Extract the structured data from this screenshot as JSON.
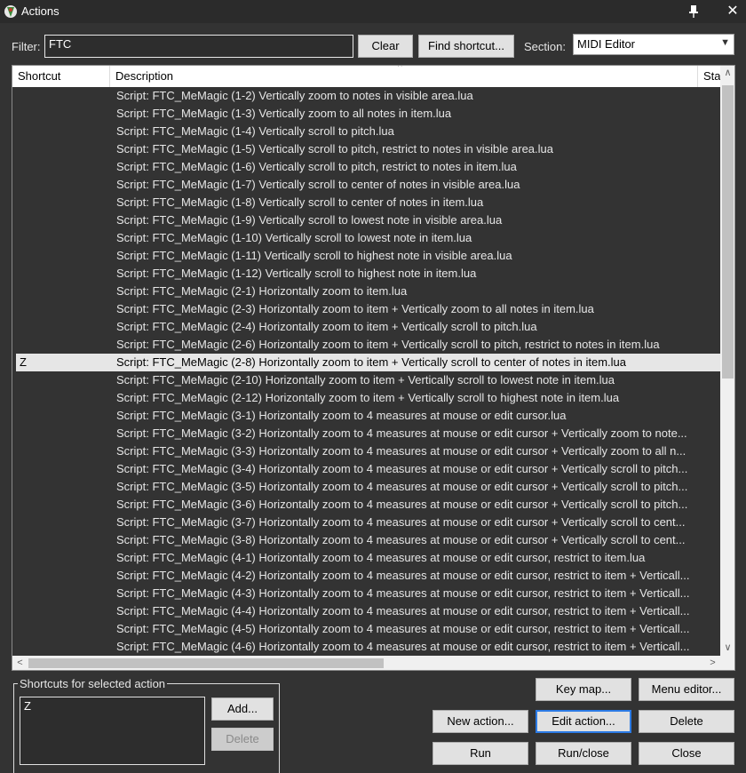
{
  "window": {
    "title": "Actions",
    "pin_glyph": "📌",
    "close_glyph": "✕"
  },
  "filter": {
    "label": "Filter:",
    "value": "FTC"
  },
  "buttons": {
    "clear": "Clear",
    "find_shortcut": "Find shortcut...",
    "key_map": "Key map...",
    "menu_editor": "Menu editor...",
    "new_action": "New action...",
    "edit_action": "Edit action...",
    "delete": "Delete",
    "run": "Run",
    "run_close": "Run/close",
    "close": "Close",
    "add": "Add...",
    "shortcut_delete": "Delete"
  },
  "section": {
    "label": "Section:",
    "value": "MIDI Editor"
  },
  "list": {
    "columns": [
      "Shortcut",
      "Description",
      "Sta"
    ],
    "rows": [
      {
        "shortcut": "",
        "description": "Script: FTC_MeMagic (1-2) Vertically zoom to notes in visible area.lua"
      },
      {
        "shortcut": "",
        "description": "Script: FTC_MeMagic (1-3) Vertically zoom to all notes in item.lua"
      },
      {
        "shortcut": "",
        "description": "Script: FTC_MeMagic (1-4) Vertically scroll to pitch.lua"
      },
      {
        "shortcut": "",
        "description": "Script: FTC_MeMagic (1-5) Vertically scroll to pitch, restrict to notes in visible area.lua"
      },
      {
        "shortcut": "",
        "description": "Script: FTC_MeMagic (1-6) Vertically scroll to pitch, restrict to notes in item.lua"
      },
      {
        "shortcut": "",
        "description": "Script: FTC_MeMagic (1-7) Vertically scroll to center of notes in visible area.lua"
      },
      {
        "shortcut": "",
        "description": "Script: FTC_MeMagic (1-8) Vertically scroll to center of notes in item.lua"
      },
      {
        "shortcut": "",
        "description": "Script: FTC_MeMagic (1-9) Vertically scroll to lowest note in visible area.lua"
      },
      {
        "shortcut": "",
        "description": "Script: FTC_MeMagic (1-10) Vertically scroll to lowest note in item.lua"
      },
      {
        "shortcut": "",
        "description": "Script: FTC_MeMagic (1-11) Vertically scroll to highest note in visible area.lua"
      },
      {
        "shortcut": "",
        "description": "Script: FTC_MeMagic (1-12) Vertically scroll to highest note in item.lua"
      },
      {
        "shortcut": "",
        "description": "Script: FTC_MeMagic (2-1) Horizontally zoom to item.lua"
      },
      {
        "shortcut": "",
        "description": "Script: FTC_MeMagic (2-3) Horizontally zoom to item + Vertically zoom to all notes in item.lua"
      },
      {
        "shortcut": "",
        "description": "Script: FTC_MeMagic (2-4) Horizontally zoom to item + Vertically scroll to pitch.lua"
      },
      {
        "shortcut": "",
        "description": "Script: FTC_MeMagic (2-6) Horizontally zoom to item + Vertically scroll to pitch, restrict to notes in item.lua"
      },
      {
        "shortcut": "Z",
        "description": "Script: FTC_MeMagic (2-8) Horizontally zoom to item + Vertically scroll to center of notes in item.lua",
        "selected": true
      },
      {
        "shortcut": "",
        "description": "Script: FTC_MeMagic (2-10) Horizontally zoom to item + Vertically scroll to lowest note in item.lua"
      },
      {
        "shortcut": "",
        "description": "Script: FTC_MeMagic (2-12) Horizontally zoom to item + Vertically scroll to highest note in item.lua"
      },
      {
        "shortcut": "",
        "description": "Script: FTC_MeMagic (3-1) Horizontally zoom to 4 measures at mouse or edit cursor.lua"
      },
      {
        "shortcut": "",
        "description": "Script: FTC_MeMagic (3-2) Horizontally zoom to 4 measures at mouse or edit cursor + Vertically zoom to note..."
      },
      {
        "shortcut": "",
        "description": "Script: FTC_MeMagic (3-3) Horizontally zoom to 4 measures at mouse or edit cursor + Vertically zoom to all n..."
      },
      {
        "shortcut": "",
        "description": "Script: FTC_MeMagic (3-4) Horizontally zoom to 4 measures at mouse or edit cursor + Vertically scroll to pitch..."
      },
      {
        "shortcut": "",
        "description": "Script: FTC_MeMagic (3-5) Horizontally zoom to 4 measures at mouse or edit cursor + Vertically scroll to pitch..."
      },
      {
        "shortcut": "",
        "description": "Script: FTC_MeMagic (3-6) Horizontally zoom to 4 measures at mouse or edit cursor + Vertically scroll to pitch..."
      },
      {
        "shortcut": "",
        "description": "Script: FTC_MeMagic (3-7) Horizontally zoom to 4 measures at mouse or edit cursor + Vertically scroll to cent..."
      },
      {
        "shortcut": "",
        "description": "Script: FTC_MeMagic (3-8) Horizontally zoom to 4 measures at mouse or edit cursor + Vertically scroll to cent..."
      },
      {
        "shortcut": "",
        "description": "Script: FTC_MeMagic (4-1) Horizontally zoom to 4 measures at mouse or edit cursor, restrict to item.lua"
      },
      {
        "shortcut": "",
        "description": "Script: FTC_MeMagic (4-2) Horizontally zoom to 4 measures at mouse or edit cursor, restrict to item + Verticall..."
      },
      {
        "shortcut": "",
        "description": "Script: FTC_MeMagic (4-3) Horizontally zoom to 4 measures at mouse or edit cursor, restrict to item + Verticall..."
      },
      {
        "shortcut": "",
        "description": "Script: FTC_MeMagic (4-4) Horizontally zoom to 4 measures at mouse or edit cursor, restrict to item + Verticall..."
      },
      {
        "shortcut": "",
        "description": "Script: FTC_MeMagic (4-5) Horizontally zoom to 4 measures at mouse or edit cursor, restrict to item + Verticall..."
      },
      {
        "shortcut": "",
        "description": "Script: FTC_MeMagic (4-6) Horizontally zoom to 4 measures at mouse or edit cursor, restrict to item + Verticall..."
      }
    ]
  },
  "shortcuts_panel": {
    "title": "Shortcuts for selected action",
    "value": "Z"
  },
  "colors": {
    "background": "#333333",
    "selected_row": "#e6e6e6",
    "focus_border": "#2c7be5"
  }
}
